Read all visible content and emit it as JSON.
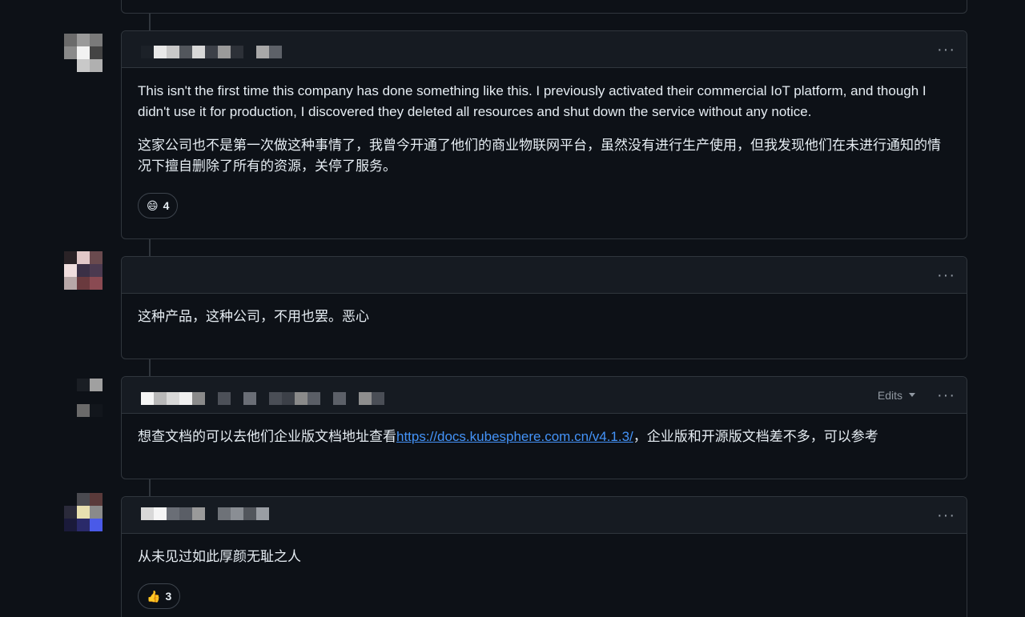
{
  "comments": [
    {
      "body": [
        "This isn't the first time this company has done something like this. I previously activated their commercial IoT platform, and though I didn't use it for production, I discovered they deleted all resources and shut down the service without any notice.",
        "这家公司也不是第一次做这种事情了，我曾今开通了他们的商业物联网平台，虽然没有进行生产使用，但我发现他们在未进行通知的情况下擅自删除了所有的资源，关停了服务。"
      ],
      "reaction": {
        "emoji": "😄",
        "count": "4"
      }
    },
    {
      "body": [
        "这种产品，这种公司，不用也罢。恶心"
      ]
    },
    {
      "edits_label": "Edits",
      "body_prefix": "想查文档的可以去他们企业版文档地址查看",
      "link_text": "https://docs.kubesphere.com.cn/v4.1.3/",
      "body_suffix": "，企业版和开源版文档差不多，可以参考"
    },
    {
      "body": [
        "从未见过如此厚颜无耻之人"
      ],
      "reaction": {
        "emoji": "👍",
        "count": "3"
      }
    }
  ],
  "menu_glyph": "···",
  "colors": {
    "link": "#4493f8",
    "background": "#0d1117",
    "header": "#161b22",
    "border": "#30363d"
  }
}
